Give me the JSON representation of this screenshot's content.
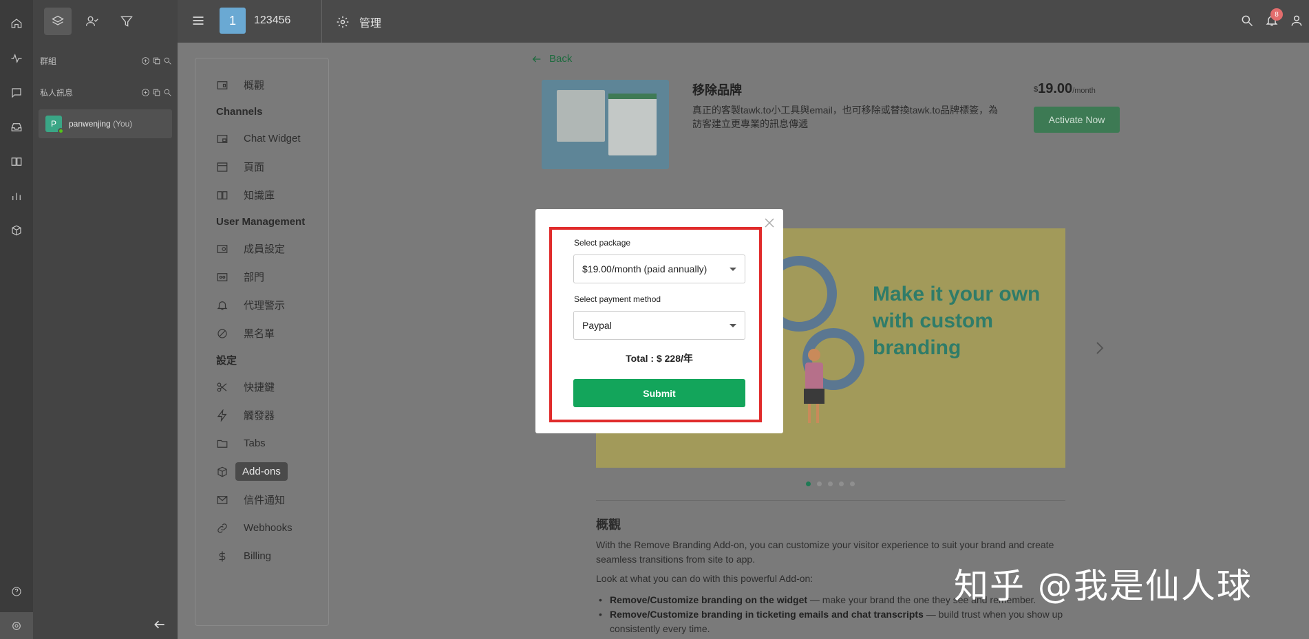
{
  "topbar": {
    "property_badge": "1",
    "property_name": "123456",
    "admin_label": "管理",
    "notification_count": "8"
  },
  "contacts": {
    "groups_label": "群組",
    "private_label": "私人訊息",
    "chat_avatar_letter": "P",
    "chat_user_name": "panwenjing",
    "chat_user_suffix": "(You)"
  },
  "sidebar": {
    "overview": "概觀",
    "channels_header": "Channels",
    "chat_widget": "Chat Widget",
    "pages": "頁面",
    "knowledge_base": "知識庫",
    "user_mgmt_header": "User Management",
    "members": "成員設定",
    "departments": "部門",
    "agent_alerts": "代理警示",
    "blacklist": "黑名單",
    "settings_header": "設定",
    "shortcuts": "快捷鍵",
    "triggers": "觸發器",
    "tabs": "Tabs",
    "addons": "Add-ons",
    "email_notifications": "信件通知",
    "webhooks": "Webhooks",
    "billing": "Billing"
  },
  "main": {
    "back_label": "Back",
    "product_title": "移除品牌",
    "product_desc": "真正的客製tawk.to小工具與email，也可移除或替換tawk.to品牌標簽，為訪客建立更專業的訊息傳遞",
    "price_currency": "$",
    "price_value": "19.00",
    "price_period": "/month",
    "activate_label": "Activate Now",
    "banner_text": "Make it your own with custom branding",
    "overview_title": "概觀",
    "overview_text": "With the Remove Branding Add-on, you can customize your visitor experience to suit your brand and create seamless transitions from site to app.",
    "overview_text2": "Look at what you can do with this powerful Add-on:",
    "bullet1_bold": "Remove/Customize branding on the widget",
    "bullet1_rest": " — make your brand the one they see and remember.",
    "bullet2_bold": "Remove/Customize branding in ticketing emails and chat transcripts",
    "bullet2_rest": " — build trust when you show up consistently every time.",
    "carousel_dots": 5,
    "carousel_active": 1
  },
  "modal": {
    "package_label": "Select package",
    "package_value": "$19.00/month (paid annually)",
    "payment_label": "Select payment method",
    "payment_value": "Paypal",
    "total_text": "Total : $ 228/年",
    "submit_label": "Submit"
  },
  "watermark": "知乎 @我是仙人球",
  "colors": {
    "accent_green": "#13a55b",
    "highlight_red": "#e02b2b",
    "badge_blue": "#6aa9d3"
  }
}
